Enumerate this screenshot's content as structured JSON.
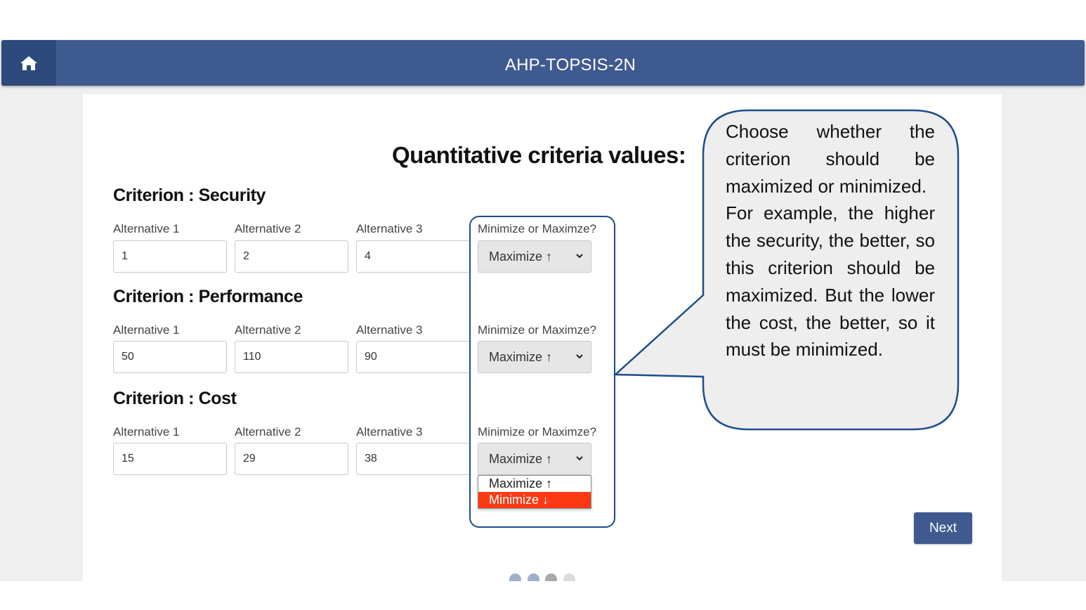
{
  "header": {
    "title": "AHP-TOPSIS-2N",
    "home_icon": "home-icon"
  },
  "main": {
    "title": "Quantitative criteria values:",
    "criteria": [
      {
        "title": "Criterion : Security",
        "labels": [
          "Alternative 1",
          "Alternative 2",
          "Alternative 3"
        ],
        "values": [
          "1",
          "2",
          "4"
        ],
        "optimize_label": "Minimize or Maximze?",
        "optimize_value": "Maximize ↑"
      },
      {
        "title": "Criterion : Performance",
        "labels": [
          "Alternative 1",
          "Alternative 2",
          "Alternative 3"
        ],
        "values": [
          "50",
          "110",
          "90"
        ],
        "optimize_label": "Minimize or Maximze?",
        "optimize_value": "Maximize ↑"
      },
      {
        "title": "Criterion : Cost",
        "labels": [
          "Alternative 1",
          "Alternative 2",
          "Alternative 3"
        ],
        "values": [
          "15",
          "29",
          "38"
        ],
        "optimize_label": "Minimize or Maximze?",
        "optimize_value": "Maximize ↑"
      }
    ],
    "dropdown_options": [
      "Maximize ↑",
      "Minimize ↓"
    ],
    "dropdown_highlighted": "Minimize ↓",
    "next_label": "Next"
  },
  "pagination": {
    "count": 4,
    "dot_colors": [
      "#9fb0cc",
      "#9fb0cc",
      "#a9a9a9",
      "#dcdcdc"
    ]
  },
  "callout": {
    "paragraph1": "Choose whether the criterion should be maximized or minimized.",
    "paragraph2": "For example, the higher the security, the better, so this criterion should be maximized. But the lower the cost, the better, so it must be minimized."
  },
  "colors": {
    "navbar": "#3f5a8f",
    "highlight_border": "#1c4d8c",
    "dropdown_selected": "#fb3a14"
  }
}
